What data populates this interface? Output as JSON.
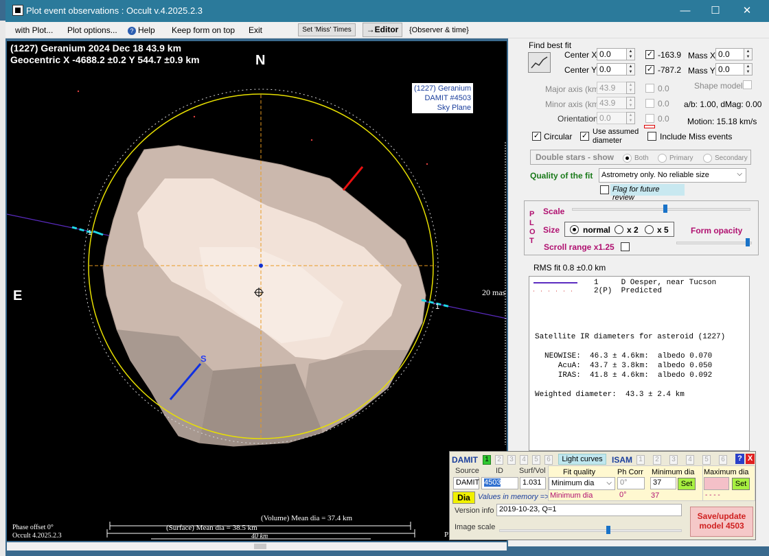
{
  "window": {
    "title": "Plot event observations : Occult v.4.2025.2.3",
    "minimize": "—",
    "maximize": "☐",
    "close": "✕"
  },
  "menu": {
    "with_plot": "with Plot...",
    "plot_options": "Plot options...",
    "help": "Help",
    "keep_on_top": "Keep form on top",
    "exit": "Exit",
    "set_miss": "Set 'Miss' Times",
    "editor": "→Editor",
    "observer_time": "{Observer & time}"
  },
  "plot": {
    "header1": "(1227) Geranium  2024 Dec 18   43.9 km",
    "header2": "Geocentric  X  -4688.2 ±0.2  Y 544.7 ±0.9 km",
    "north": "N",
    "east": "E",
    "south": "S",
    "label_lines": [
      "(1227) Geranium",
      "DAMIT #4503",
      "Sky Plane"
    ],
    "scale_mas": "20 mas",
    "chord_label": "1",
    "phase_offset": "Phase offset 0°",
    "version": "Occult 4.2025.2.3",
    "volume_dia": "(Volume) Mean dia = 37.4 km",
    "surface_dia": "(Surface) Mean dia = 38.5 km",
    "scale_km": "40 km"
  },
  "fit": {
    "title": "Find best fit",
    "center_x_label": "Center X",
    "center_x": "0.0",
    "center_y_label": "Center Y",
    "center_y": "0.0",
    "mass_x_label": "Mass X",
    "mass_x": "0.0",
    "mass_y_label": "Mass Y",
    "mass_y": "0.0",
    "geo_x": "-163.9",
    "geo_y": "-787.2",
    "major_label": "Major axis (km)",
    "major": "43.9",
    "minor_label": "Minor axis (km)",
    "minor": "43.9",
    "orient_label": "Orientation",
    "orient": "0.0",
    "zero": "0.0",
    "shape_model": "Shape model",
    "ab": "a/b: 1.00, dMag: 0.00",
    "motion": "Motion: 15.18 km/s",
    "circular": "Circular",
    "use_assumed": "Use assumed",
    "diameter": "diameter",
    "include_miss": "Include Miss events",
    "double_stars": "Double stars - show",
    "both": "Both",
    "primary": "Primary",
    "secondary": "Secondary",
    "quality_label": "Quality of the fit",
    "quality_value": "Astrometry only. No reliable size",
    "flag_review": "Flag for future review"
  },
  "plotbox": {
    "letters": [
      "P",
      "L",
      "O",
      "T"
    ],
    "scale": "Scale",
    "size": "Size",
    "normal": "normal",
    "x2": "x 2",
    "x5": "x 5",
    "form_opacity": "Form opacity",
    "scroll_range": "Scroll range x1.25"
  },
  "rms": "RMS fit 0.8 ±0.0 km",
  "results": {
    "line1": "1     D Oesper, near Tucson",
    "line2": "2(P)  Predicted",
    "sat_header": "Satellite IR diameters for asteroid (1227)",
    "neowise": "NEOWISE:  46.3 ± 4.6km:  albedo 0.070",
    "acua": "   AcuA:  43.7 ± 3.8km:  albedo 0.050",
    "iras": "   IRAS:  41.8 ± 4.6km:  albedo 0.092",
    "weighted": "Weighted diameter:  43.3 ± 2.4 km"
  },
  "damit": {
    "label": "DAMIT",
    "nums": [
      "1",
      "2",
      "3",
      "4",
      "5",
      "6"
    ],
    "light_curves": "Light curves",
    "isam": "ISAM",
    "help": "?",
    "close": "X",
    "source_label": "Source",
    "source": "DAMIT",
    "id_label": "ID",
    "id": "4503",
    "surfvol_label": "Surf/Vol",
    "surfvol": "1.031",
    "fitq_label": "Fit quality",
    "fitq": "Minimum dia",
    "phcorr_label": "Ph Corr",
    "phcorr": "0°",
    "mindia_label": "Minimum dia",
    "mindia": "37",
    "maxdia_label": "Maximum dia",
    "set": "Set",
    "dia": "Dia",
    "values_mem": "Values in memory =>",
    "mem_fitq": "Minimum dia",
    "mem_phcorr": "0°",
    "mem_min": "37",
    "mem_max": "- - - -",
    "version_label": "Version info",
    "version": "2019-10-23, Q=1",
    "image_scale": "Image scale",
    "save": "Save/update model 4503"
  },
  "pl_cut": "Pl"
}
